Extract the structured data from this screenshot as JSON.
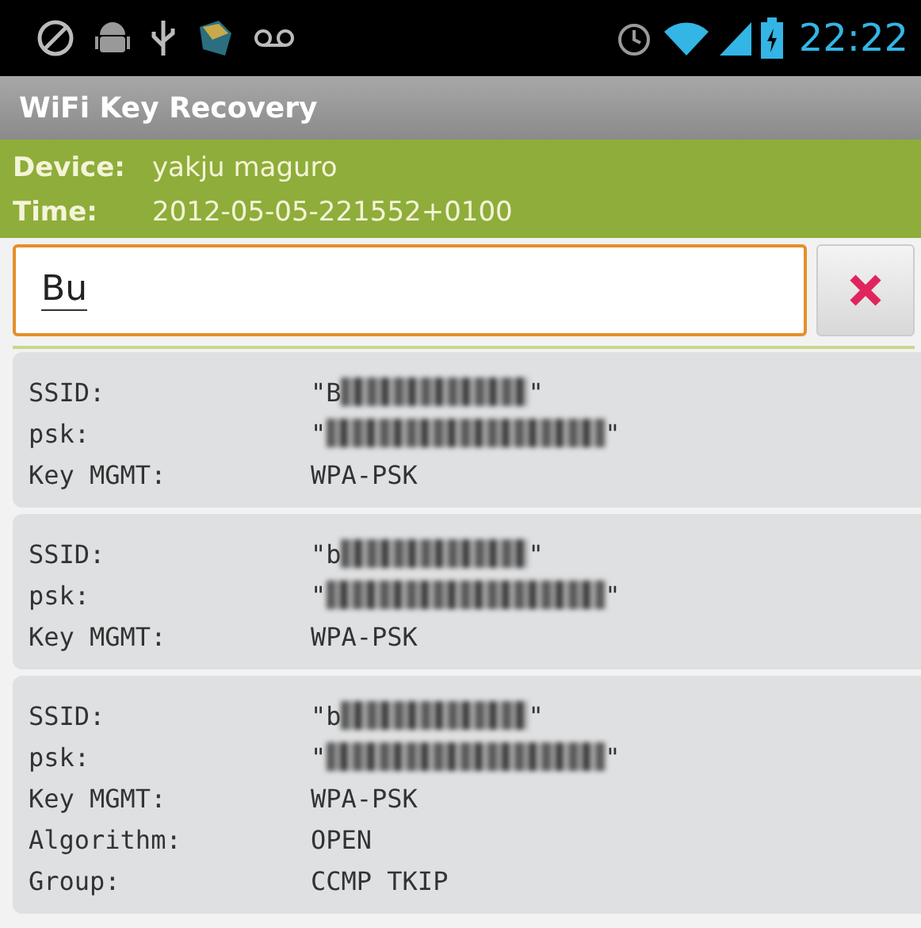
{
  "status_bar": {
    "time": "22:22"
  },
  "title_bar": {
    "title": "WiFi Key Recovery"
  },
  "header": {
    "rows": [
      {
        "label": "Device:",
        "value": "yakju maguro"
      },
      {
        "label": "Time:",
        "value": "2012-05-05-221552+0100"
      }
    ]
  },
  "search": {
    "value": "Bu"
  },
  "networks": [
    {
      "fields": [
        {
          "kind": "short",
          "label": "SSID:",
          "before": "\"B",
          "after": "\""
        },
        {
          "kind": "long",
          "label": "psk:",
          "before": "\"",
          "after": "\""
        },
        {
          "kind": "plain",
          "label": "Key MGMT:",
          "value": "WPA-PSK"
        }
      ]
    },
    {
      "fields": [
        {
          "kind": "short",
          "label": "SSID:",
          "before": "\"b",
          "after": "\""
        },
        {
          "kind": "long",
          "label": "psk:",
          "before": "\"",
          "after": "\""
        },
        {
          "kind": "plain",
          "label": "Key MGMT:",
          "value": "WPA-PSK"
        }
      ]
    },
    {
      "fields": [
        {
          "kind": "short",
          "label": "SSID:",
          "before": "\"b",
          "after": "\""
        },
        {
          "kind": "long",
          "label": "psk:",
          "before": "\"",
          "after": "\""
        },
        {
          "kind": "plain",
          "label": "Key MGMT:",
          "value": "WPA-PSK"
        },
        {
          "kind": "plain",
          "label": "Algorithm:",
          "value": "OPEN"
        },
        {
          "kind": "plain",
          "label": "Group:",
          "value": "CCMP TKIP"
        }
      ]
    }
  ]
}
